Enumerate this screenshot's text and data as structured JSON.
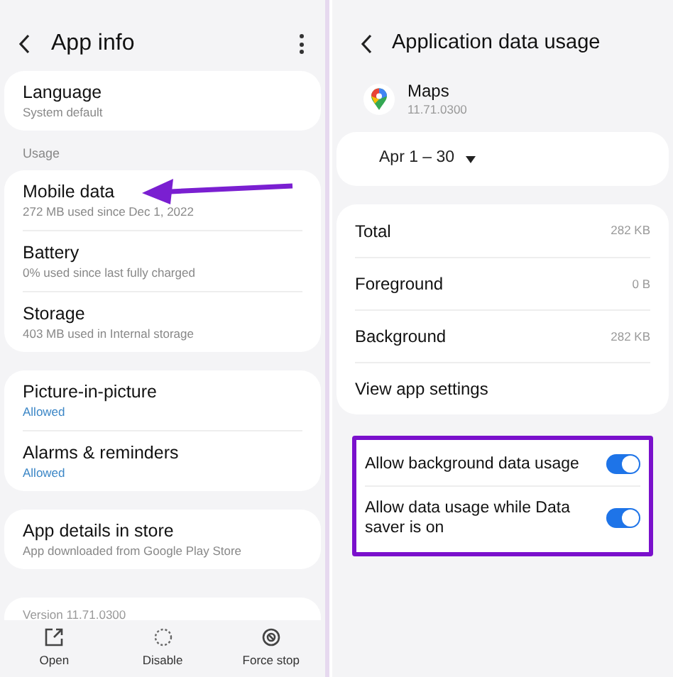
{
  "app_info": {
    "title": "App info",
    "cards": [
      {
        "items": [
          {
            "title": "Language",
            "subtitle": "System default",
            "accent": false,
            "annotated": false
          }
        ]
      },
      {
        "label": "Usage",
        "items": [
          {
            "title": "Mobile data",
            "subtitle": "272 MB used since Dec 1, 2022",
            "accent": false,
            "annotated": true
          },
          {
            "title": "Battery",
            "subtitle": "0% used since last fully charged",
            "accent": false,
            "annotated": false
          },
          {
            "title": "Storage",
            "subtitle": "403 MB used in Internal storage",
            "accent": false,
            "annotated": false
          }
        ]
      },
      {
        "items": [
          {
            "title": "Picture-in-picture",
            "subtitle": "Allowed",
            "accent": true,
            "annotated": false
          },
          {
            "title": "Alarms & reminders",
            "subtitle": "Allowed",
            "accent": true,
            "annotated": false
          }
        ]
      },
      {
        "items": [
          {
            "title": "App details in store",
            "subtitle": "App downloaded from Google Play Store",
            "accent": false,
            "annotated": false
          }
        ]
      }
    ],
    "version": "Version 11.71.0300",
    "actions": [
      {
        "label": "Open",
        "kind": "open"
      },
      {
        "label": "Disable",
        "kind": "disable"
      },
      {
        "label": "Force stop",
        "kind": "stop"
      }
    ]
  },
  "data_usage": {
    "title": "Application data usage",
    "app": {
      "name": "Maps",
      "version": "11.71.0300"
    },
    "period": "Apr 1 – 30",
    "rows": [
      {
        "label": "Total",
        "value": "282 KB"
      },
      {
        "label": "Foreground",
        "value": "0 B"
      },
      {
        "label": "Background",
        "value": "282 KB"
      },
      {
        "label": "View app settings"
      }
    ],
    "toggles": [
      {
        "label": "Allow background data usage",
        "on": true
      },
      {
        "label": "Allow data usage while Data saver is on",
        "on": true
      }
    ],
    "toggles_highlighted": true
  }
}
